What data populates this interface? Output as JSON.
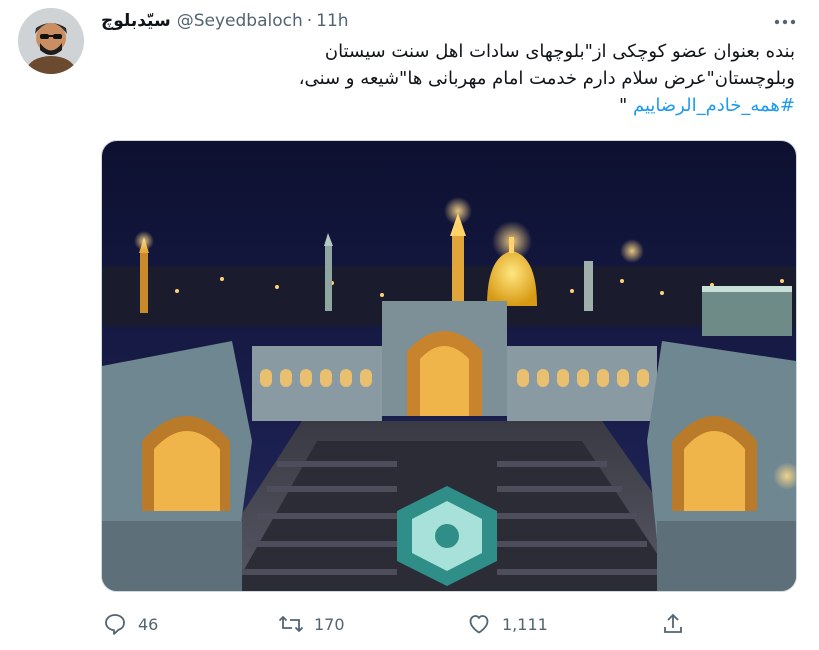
{
  "tweet": {
    "display_name": "سیّدبلوچ",
    "handle": "@Seyedbaloch",
    "separator": "·",
    "time": "11h",
    "more_icon": "more-icon",
    "text_lines": [
      "بنده بعنوان عضو کوچکی از\"بلوچهای سادات اهل سنت سیستان",
      "وبلوچستان\"عرض سلام دارم خدمت امام مهربانی ها\"شیعه و سنی،"
    ],
    "hashtag": "#همه_خادم_الرضاییم",
    "closing_quote": "\"",
    "image_icon": "shrine-photo"
  },
  "actions": {
    "reply": {
      "icon": "reply-icon",
      "count": "46"
    },
    "retweet": {
      "icon": "retweet-icon",
      "count": "170"
    },
    "like": {
      "icon": "heart-icon",
      "count": "1,111"
    },
    "share": {
      "icon": "share-icon"
    }
  },
  "colors": {
    "text": "#0f1419",
    "secondary": "#536471",
    "link": "#1d9bf0",
    "border": "#cfd9de"
  }
}
